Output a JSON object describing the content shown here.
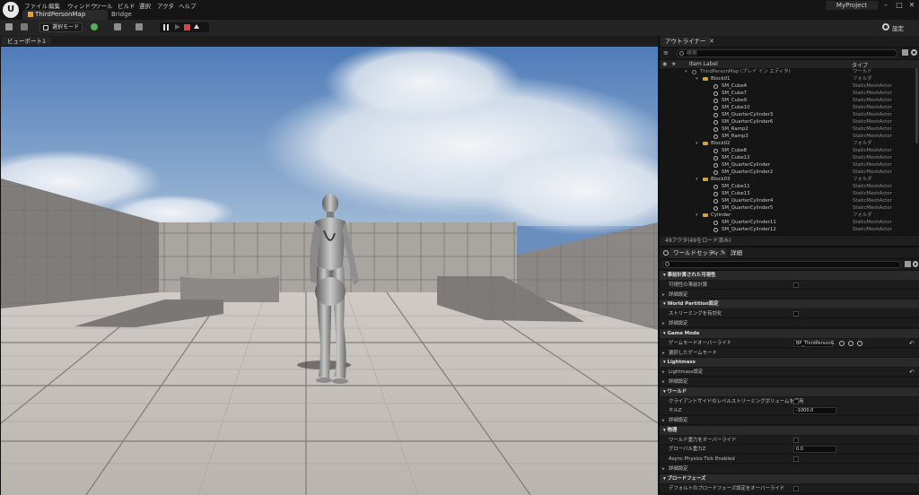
{
  "app": {
    "logo": "U",
    "project_name": "MyProject"
  },
  "menu": [
    "ファイル",
    "編集",
    "ウィンドウ",
    "ツール",
    "ビルド",
    "選択",
    "アクタ",
    "ヘルプ"
  ],
  "tabs": {
    "map": "ThirdPersonMap",
    "bridge": "Bridge"
  },
  "toolbar": {
    "select_mode": "選択モード",
    "settings": "設定"
  },
  "viewport": {
    "tab_label": "ビューポート1"
  },
  "outliner": {
    "tab_label": "アウトライナー",
    "search_placeholder": "検索",
    "col_label": "Item Label",
    "col_type": "タイプ",
    "rows": [
      {
        "label": "ThirdPersonMap (プレイ イン エディタ)",
        "type": "ワールド",
        "kind": "world",
        "depth": 0
      },
      {
        "label": "Block01",
        "type": "フォルダ",
        "kind": "folder",
        "depth": 1
      },
      {
        "label": "SM_Cube4",
        "type": "StaticMeshActor",
        "kind": "mesh",
        "depth": 2
      },
      {
        "label": "SM_Cube7",
        "type": "StaticMeshActor",
        "kind": "mesh",
        "depth": 2
      },
      {
        "label": "SM_Cube9",
        "type": "StaticMeshActor",
        "kind": "mesh",
        "depth": 2
      },
      {
        "label": "SM_Cube10",
        "type": "StaticMeshActor",
        "kind": "mesh",
        "depth": 2
      },
      {
        "label": "SM_QuarterCylinder3",
        "type": "StaticMeshActor",
        "kind": "mesh",
        "depth": 2
      },
      {
        "label": "SM_QuarterCylinder6",
        "type": "StaticMeshActor",
        "kind": "mesh",
        "depth": 2
      },
      {
        "label": "SM_Ramp2",
        "type": "StaticMeshActor",
        "kind": "mesh",
        "depth": 2
      },
      {
        "label": "SM_Ramp3",
        "type": "StaticMeshActor",
        "kind": "mesh",
        "depth": 2
      },
      {
        "label": "Block02",
        "type": "フォルダ",
        "kind": "folder",
        "depth": 1
      },
      {
        "label": "SM_Cube8",
        "type": "StaticMeshActor",
        "kind": "mesh",
        "depth": 2
      },
      {
        "label": "SM_Cube12",
        "type": "StaticMeshActor",
        "kind": "mesh",
        "depth": 2
      },
      {
        "label": "SM_QuarterCylinder",
        "type": "StaticMeshActor",
        "kind": "mesh",
        "depth": 2
      },
      {
        "label": "SM_QuarterCylinder2",
        "type": "StaticMeshActor",
        "kind": "mesh",
        "depth": 2
      },
      {
        "label": "Block03",
        "type": "フォルダ",
        "kind": "folder",
        "depth": 1
      },
      {
        "label": "SM_Cube11",
        "type": "StaticMeshActor",
        "kind": "mesh",
        "depth": 2
      },
      {
        "label": "SM_Cube13",
        "type": "StaticMeshActor",
        "kind": "mesh",
        "depth": 2
      },
      {
        "label": "SM_QuarterCylinder4",
        "type": "StaticMeshActor",
        "kind": "mesh",
        "depth": 2
      },
      {
        "label": "SM_QuarterCylinder5",
        "type": "StaticMeshActor",
        "kind": "mesh",
        "depth": 2
      },
      {
        "label": "Cylinder",
        "type": "フォルダ",
        "kind": "folder",
        "depth": 1
      },
      {
        "label": "SM_QuarterCylinder11",
        "type": "StaticMeshActor",
        "kind": "mesh",
        "depth": 2
      },
      {
        "label": "SM_QuarterCylinder12",
        "type": "StaticMeshActor",
        "kind": "mesh",
        "depth": 2
      }
    ],
    "status": "49アクタ(49をロード済み)"
  },
  "details": {
    "tab_world_settings": "ワールドセッティ..",
    "tab_details": "詳細",
    "items": [
      {
        "kind": "section",
        "label": "事前計算された可視性"
      },
      {
        "kind": "prop",
        "label": "可視性の事前計算",
        "control": "checkbox"
      },
      {
        "kind": "prop",
        "label": "詳細設定",
        "control": "none",
        "expander": true
      },
      {
        "kind": "section",
        "label": "World Partition設定"
      },
      {
        "kind": "prop",
        "label": "ストリーミングを有効化",
        "control": "checkbox"
      },
      {
        "kind": "prop",
        "label": "詳細設定",
        "control": "none",
        "expander": true
      },
      {
        "kind": "section",
        "label": "Game Mode"
      },
      {
        "kind": "prop",
        "label": "ゲームモードオーバーライド",
        "control": "dropdown",
        "value": "BP_ThirdPersonG",
        "revert": true
      },
      {
        "kind": "prop",
        "label": "選択したゲームモード",
        "control": "none",
        "expander": true
      },
      {
        "kind": "section",
        "label": "Lightmass"
      },
      {
        "kind": "prop",
        "label": "Lightmass設定",
        "control": "none",
        "expander": true,
        "revert": true
      },
      {
        "kind": "prop",
        "label": "詳細設定",
        "control": "none",
        "expander": true
      },
      {
        "kind": "section",
        "label": "ワールド"
      },
      {
        "kind": "prop",
        "label": "クライアントサイドのレベルストリーミングボリュームを使用",
        "control": "checkbox"
      },
      {
        "kind": "prop",
        "label": "キルZ",
        "control": "field",
        "value": "-1000.0"
      },
      {
        "kind": "prop",
        "label": "詳細設定",
        "control": "none",
        "expander": true
      },
      {
        "kind": "section",
        "label": "物理"
      },
      {
        "kind": "prop",
        "label": "ワールド重力をオーバーライド",
        "control": "checkbox"
      },
      {
        "kind": "prop",
        "label": "グローバル重力Z",
        "control": "field",
        "value": "0.0"
      },
      {
        "kind": "prop",
        "label": "Async Physics Tick Enabled",
        "control": "checkbox"
      },
      {
        "kind": "prop",
        "label": "詳細設定",
        "control": "none",
        "expander": true
      },
      {
        "kind": "section",
        "label": "ブロードフェーズ"
      },
      {
        "kind": "prop",
        "label": "デフォルトのブロードフェーズ設定をオーバーライド",
        "control": "checkbox"
      }
    ]
  },
  "colors": {
    "sky": "#5f86bd",
    "floor": "#bdb8b3",
    "wall": "#8f8c89",
    "accent": "#4a7fd6"
  }
}
